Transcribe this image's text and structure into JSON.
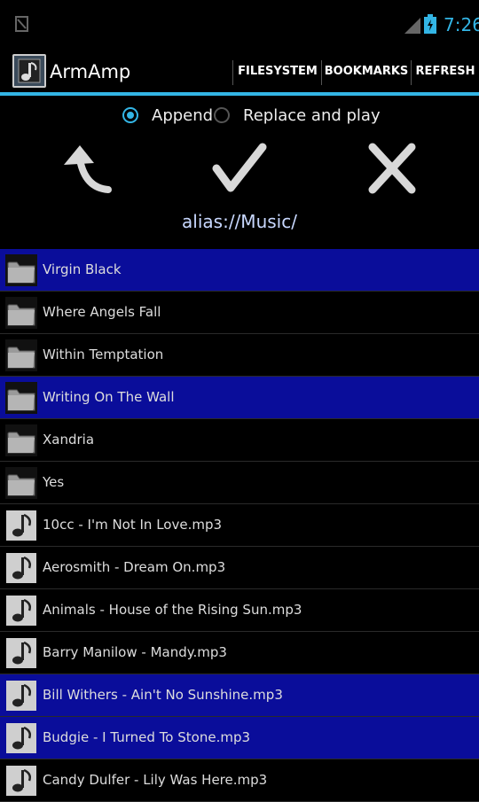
{
  "status": {
    "time": "7:26"
  },
  "action_bar": {
    "title": "ArmAmp",
    "buttons": [
      "FILESYSTEM",
      "BOOKMARKS",
      "REFRESH"
    ]
  },
  "mode": {
    "options": [
      {
        "label": "Append",
        "selected": true
      },
      {
        "label": "Replace and play",
        "selected": false
      }
    ]
  },
  "controls": {
    "icons": [
      "back-arrow-icon",
      "checkmark-icon",
      "close-x-icon"
    ]
  },
  "path": "alias://Music/",
  "colors": {
    "accent": "#33b5e5",
    "selected_row": "#0a0d9a",
    "background": "#000000"
  },
  "items": [
    {
      "name": "Virgin Black",
      "type": "folder",
      "selected": true
    },
    {
      "name": "Where Angels Fall",
      "type": "folder",
      "selected": false
    },
    {
      "name": "Within Temptation",
      "type": "folder",
      "selected": false
    },
    {
      "name": "Writing On The Wall",
      "type": "folder",
      "selected": true
    },
    {
      "name": "Xandria",
      "type": "folder",
      "selected": false
    },
    {
      "name": "Yes",
      "type": "folder",
      "selected": false
    },
    {
      "name": "10cc - I'm Not In Love.mp3",
      "type": "file",
      "selected": false
    },
    {
      "name": "Aerosmith - Dream On.mp3",
      "type": "file",
      "selected": false
    },
    {
      "name": "Animals - House of the Rising Sun.mp3",
      "type": "file",
      "selected": false
    },
    {
      "name": "Barry Manilow - Mandy.mp3",
      "type": "file",
      "selected": false
    },
    {
      "name": "Bill Withers - Ain't No Sunshine.mp3",
      "type": "file",
      "selected": true
    },
    {
      "name": "Budgie - I Turned To Stone.mp3",
      "type": "file",
      "selected": true
    },
    {
      "name": "Candy Dulfer - Lily Was Here.mp3",
      "type": "file",
      "selected": false
    }
  ]
}
